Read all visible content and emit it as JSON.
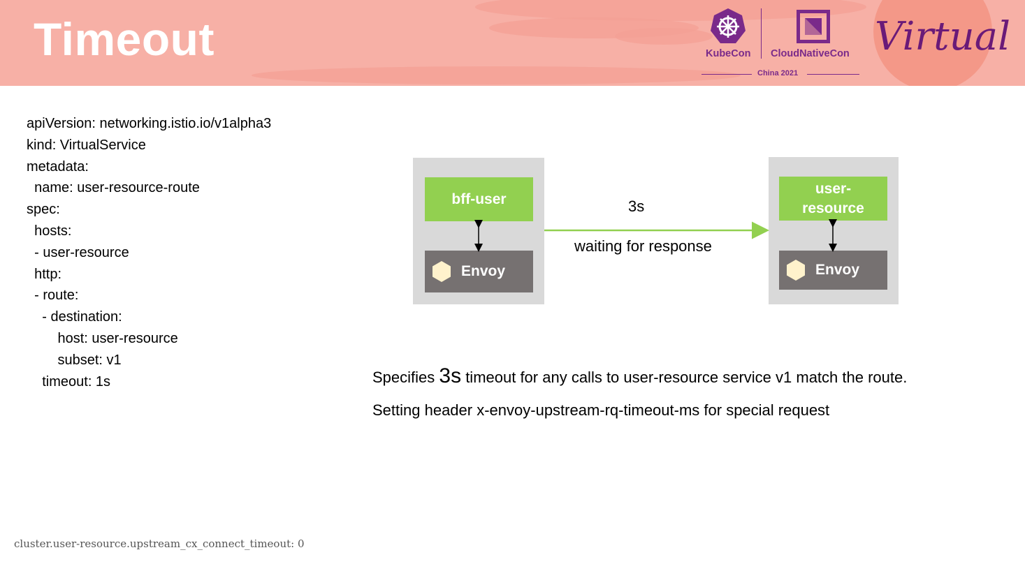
{
  "header": {
    "title": "Timeout",
    "logos": {
      "kubecon": "KubeCon",
      "cloudnativecon": "CloudNativeCon",
      "event": "China 2021",
      "virtual": "Virtual"
    },
    "colors": {
      "banner": "#f7b0a6",
      "brand_purple": "#7a2a8a"
    }
  },
  "yaml_lines": [
    "apiVersion: networking.istio.io/v1alpha3",
    "kind: VirtualService",
    "metadata:",
    "  name: user-resource-route",
    "spec:",
    "  hosts:",
    "  - user-resource",
    "  http:",
    "  - route:",
    "    - destination:",
    "        host: user-resource",
    "        subset: v1",
    "    timeout: 1s"
  ],
  "diagram": {
    "left_service": "bff-user",
    "left_proxy": "Envoy",
    "right_service": "user-\nresource",
    "right_proxy": "Envoy",
    "arrow_top_label": "3s",
    "arrow_bottom_label": "waiting for response",
    "proxy_icon": "hexagon-icon",
    "colors": {
      "service": "#92d050",
      "proxy": "#767171",
      "pod": "#d9d9d9",
      "hexagon": "#fff2cc"
    }
  },
  "description": {
    "line1_prefix": "Specifies ",
    "line1_value": "3s",
    "line1_suffix": " timeout for any calls to user-resource service v1 match the route.",
    "line2": "Setting header x-envoy-upstream-rq-timeout-ms for special request"
  },
  "footer": {
    "code": "cluster.user-resource.upstream_cx_connect_timeout: 0"
  }
}
